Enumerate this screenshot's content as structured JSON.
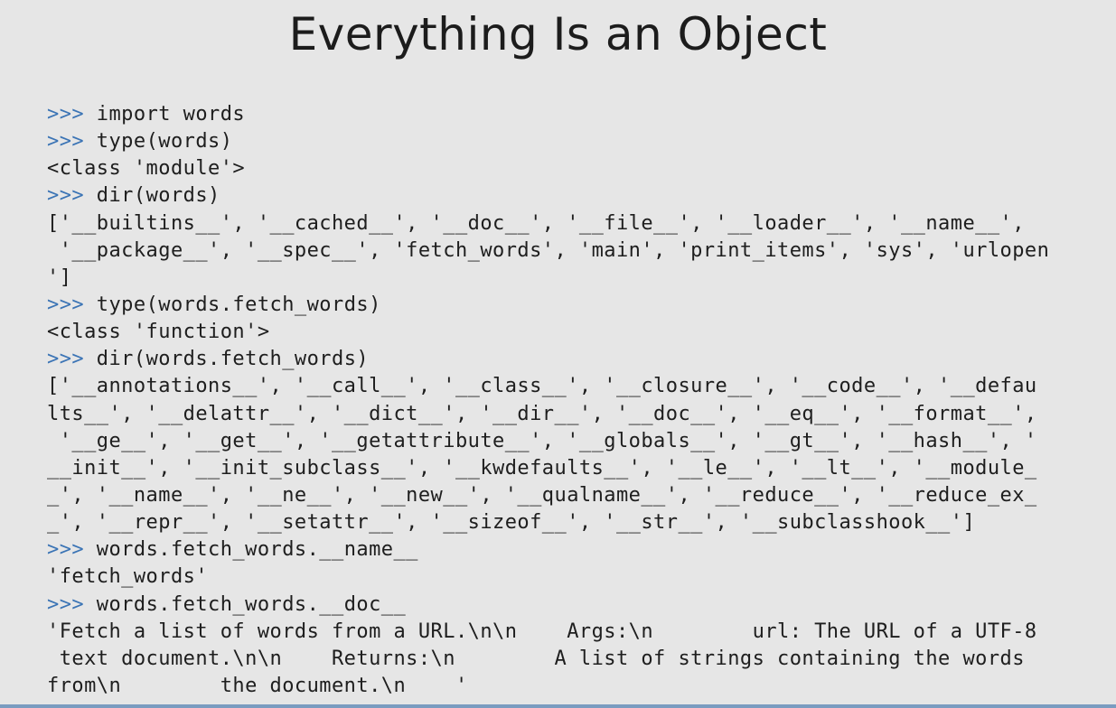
{
  "slide": {
    "title": "Everything Is an Object"
  },
  "code": {
    "prompt": ">>>",
    "lines": [
      {
        "type": "input",
        "text": " import words"
      },
      {
        "type": "input",
        "text": " type(words)"
      },
      {
        "type": "output",
        "text": "<class 'module'>"
      },
      {
        "type": "input",
        "text": " dir(words)"
      },
      {
        "type": "output",
        "text": "['__builtins__', '__cached__', '__doc__', '__file__', '__loader__', '__name__',"
      },
      {
        "type": "output",
        "text": " '__package__', '__spec__', 'fetch_words', 'main', 'print_items', 'sys', 'urlopen"
      },
      {
        "type": "output",
        "text": "']"
      },
      {
        "type": "input",
        "text": " type(words.fetch_words)"
      },
      {
        "type": "output",
        "text": "<class 'function'>"
      },
      {
        "type": "input",
        "text": " dir(words.fetch_words)"
      },
      {
        "type": "output",
        "text": "['__annotations__', '__call__', '__class__', '__closure__', '__code__', '__defau"
      },
      {
        "type": "output",
        "text": "lts__', '__delattr__', '__dict__', '__dir__', '__doc__', '__eq__', '__format__',"
      },
      {
        "type": "output",
        "text": " '__ge__', '__get__', '__getattribute__', '__globals__', '__gt__', '__hash__', '"
      },
      {
        "type": "output",
        "text": "__init__', '__init_subclass__', '__kwdefaults__', '__le__', '__lt__', '__module_"
      },
      {
        "type": "output",
        "text": "_', '__name__', '__ne__', '__new__', '__qualname__', '__reduce__', '__reduce_ex_"
      },
      {
        "type": "output",
        "text": "_', '__repr__', '__setattr__', '__sizeof__', '__str__', '__subclasshook__']"
      },
      {
        "type": "input",
        "text": " words.fetch_words.__name__"
      },
      {
        "type": "output",
        "text": "'fetch_words'"
      },
      {
        "type": "input",
        "text": " words.fetch_words.__doc__"
      },
      {
        "type": "output",
        "text": "'Fetch a list of words from a URL.\\n\\n    Args:\\n        url: The URL of a UTF-8"
      },
      {
        "type": "output",
        "text": " text document.\\n\\n    Returns:\\n        A list of strings containing the words"
      },
      {
        "type": "output",
        "text": "from\\n        the document.\\n    '"
      }
    ]
  },
  "colors": {
    "background": "#e6e6e6",
    "prompt": "#3b74b5",
    "text": "#1e1e1e"
  }
}
